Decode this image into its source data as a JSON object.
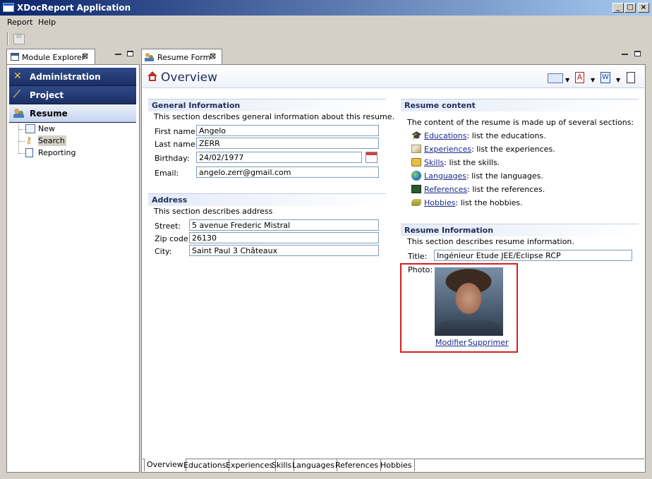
{
  "app": {
    "title": "XDocReport Application"
  },
  "menu": [
    "Report",
    "Help"
  ],
  "left_view": {
    "tab_label": "Module Explorer",
    "nav": [
      {
        "label": "Administration",
        "icon": "tools-icon"
      },
      {
        "label": "Project",
        "icon": "hammer-icon"
      },
      {
        "label": "Resume",
        "icon": "users-icon"
      }
    ],
    "tree": [
      {
        "label": "New",
        "icon": "form-icon"
      },
      {
        "label": "Search",
        "icon": "key-search-icon"
      },
      {
        "label": "Reporting",
        "icon": "report-icon"
      }
    ]
  },
  "editor": {
    "tab_label": "Resume Form",
    "page_title": "Overview"
  },
  "general": {
    "title": "General Information",
    "description": "This section describes general information about this resume.",
    "first_name_label": "First name:",
    "first_name": "Angelo",
    "last_name_label": "Last name:",
    "last_name": "ZERR",
    "birthday_label": "Birthday:",
    "birthday": "24/02/1977",
    "email_label": "Email:",
    "email": "angelo.zerr@gmail.com"
  },
  "address": {
    "title": "Address",
    "description": "This section describes address",
    "street_label": "Street:",
    "street": "5 avenue Frederic Mistral",
    "zip_label": "Zip code:",
    "zip": "26130",
    "city_label": "City:",
    "city": "Saint Paul 3 Châteaux"
  },
  "resume_content": {
    "title": "Resume content",
    "description": "The content of the resume is made up of several sections:",
    "items": [
      {
        "link": "Educations",
        "text": ": list the educations.",
        "icon": "graduation-cap-icon"
      },
      {
        "link": "Experiences",
        "text": ": list the experiences.",
        "icon": "experience-icon"
      },
      {
        "link": "Skills",
        "text": ": list the skills.",
        "icon": "skills-icon"
      },
      {
        "link": "Languages",
        "text": ": list the languages.",
        "icon": "globe-icon"
      },
      {
        "link": "References",
        "text": ": list the references.",
        "icon": "references-icon"
      },
      {
        "link": "Hobbies",
        "text": ": list the hobbies.",
        "icon": "hobbies-icon"
      }
    ]
  },
  "resume_info": {
    "title": "Resume Information",
    "description": "This section describes resume information.",
    "title_label": "Title:",
    "title_value": "Ingénieur Etude JEE/Eclipse RCP",
    "photo_label": "Photo:",
    "modify_link": "Modifier",
    "delete_link": "Supprimer"
  },
  "bottom_tabs": [
    "Overview",
    "Educations",
    "Experiences",
    "Skills",
    "Languages",
    "References",
    "Hobbies"
  ],
  "colors": {
    "section_title": "#1e2e5a",
    "nav_dark": "#1c2f64",
    "highlight": "#d22020"
  }
}
